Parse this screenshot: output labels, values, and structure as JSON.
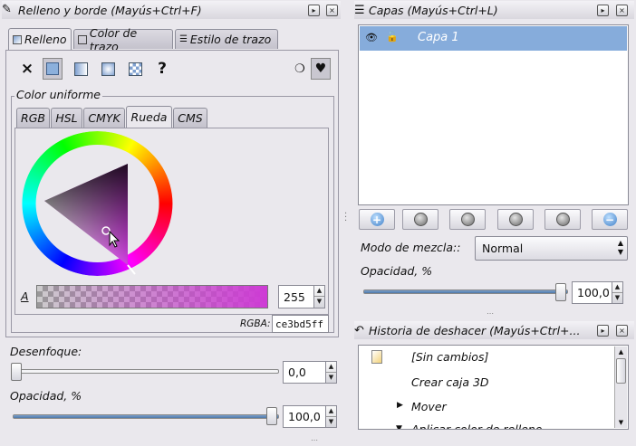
{
  "fill_stroke": {
    "title": "Relleno y borde (Mayús+Ctrl+F)",
    "tabs": [
      "Relleno",
      "Color de trazo",
      "Estilo de trazo"
    ],
    "paint_type_none": "×",
    "paint_type_unknown": "?",
    "section_title": "Color uniforme",
    "mode_tabs": [
      "RGB",
      "HSL",
      "CMYK",
      "Rueda",
      "CMS"
    ],
    "alpha_label": "A",
    "alpha_value": "255",
    "rgba_label": "RGBA:",
    "rgba_value": "ce3bd5ff",
    "blur_label": "Desenfoque:",
    "blur_value": "0,0",
    "blur_level": 0,
    "opacity_label": "Opacidad, %",
    "opacity_value": "100,0",
    "opacity_level": 100
  },
  "layers": {
    "title": "Capas (Mayús+Ctrl+L)",
    "layer_name": "Capa 1",
    "blend_label": "Modo de mezcla::",
    "blend_value": "Normal",
    "opacity_label": "Opacidad, %",
    "opacity_value": "100,0",
    "opacity_level": 100
  },
  "history": {
    "title": "Historia de deshacer (Mayús+Ctrl+...",
    "items": [
      "[Sin cambios]",
      "Crear caja 3D",
      "Mover",
      "Aplicar color de relleno"
    ]
  },
  "colors": {
    "selection": "#86acdb",
    "fill_color": "#ce3bd5"
  }
}
